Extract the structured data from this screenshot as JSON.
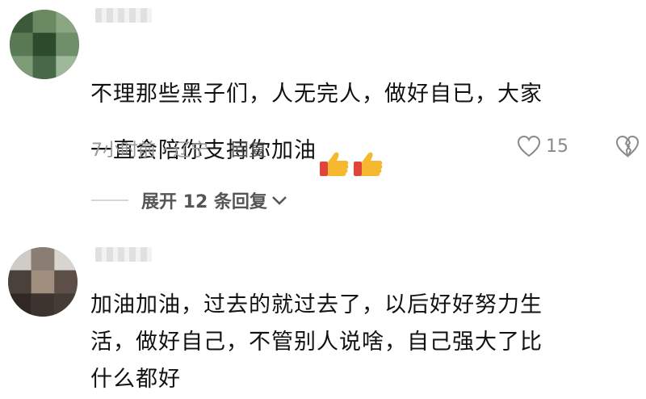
{
  "comments": [
    {
      "text": "不理那些黑子们，人无完人，做好自已，大家\n一直会陪你支持你加油",
      "emoji": [
        "thumbs-up-emoji",
        "thumbs-up-emoji"
      ],
      "time_location": "7小时前 · 辽宁",
      "reply_label": "回复",
      "like_count": "15",
      "expand_label": "展开 12 条回复"
    },
    {
      "text": "加油加油，过去的就过去了，以后好好努力生\n活，做好自己，不管别人说啥，自己强大了比\n什么都好"
    }
  ]
}
